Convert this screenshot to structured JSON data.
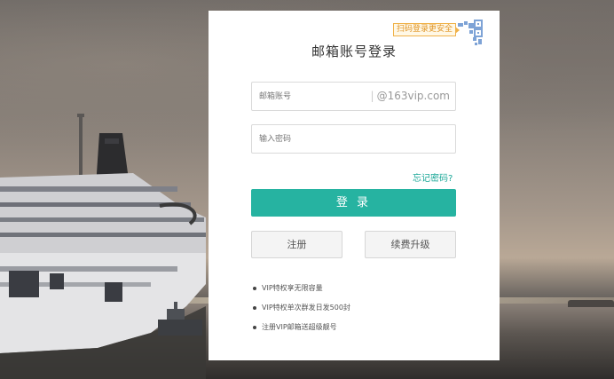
{
  "login": {
    "title": "邮箱账号登录",
    "qr_tip": "扫码登录更安全",
    "account_placeholder": "邮箱账号",
    "domain_suffix": "@163vip.com",
    "password_placeholder": "输入密码",
    "forgot_password": "忘记密码?",
    "login_button": "登 录",
    "register_button": "注册",
    "renew_button": "续费升级"
  },
  "features": [
    "VIP特权享无限容量",
    "VIP特权单次群发日发500封",
    "注册VIP邮箱送超级靓号"
  ],
  "colors": {
    "accent": "#26b3a1",
    "link": "#1aa797",
    "qr_tip_border": "#f0b24a"
  }
}
